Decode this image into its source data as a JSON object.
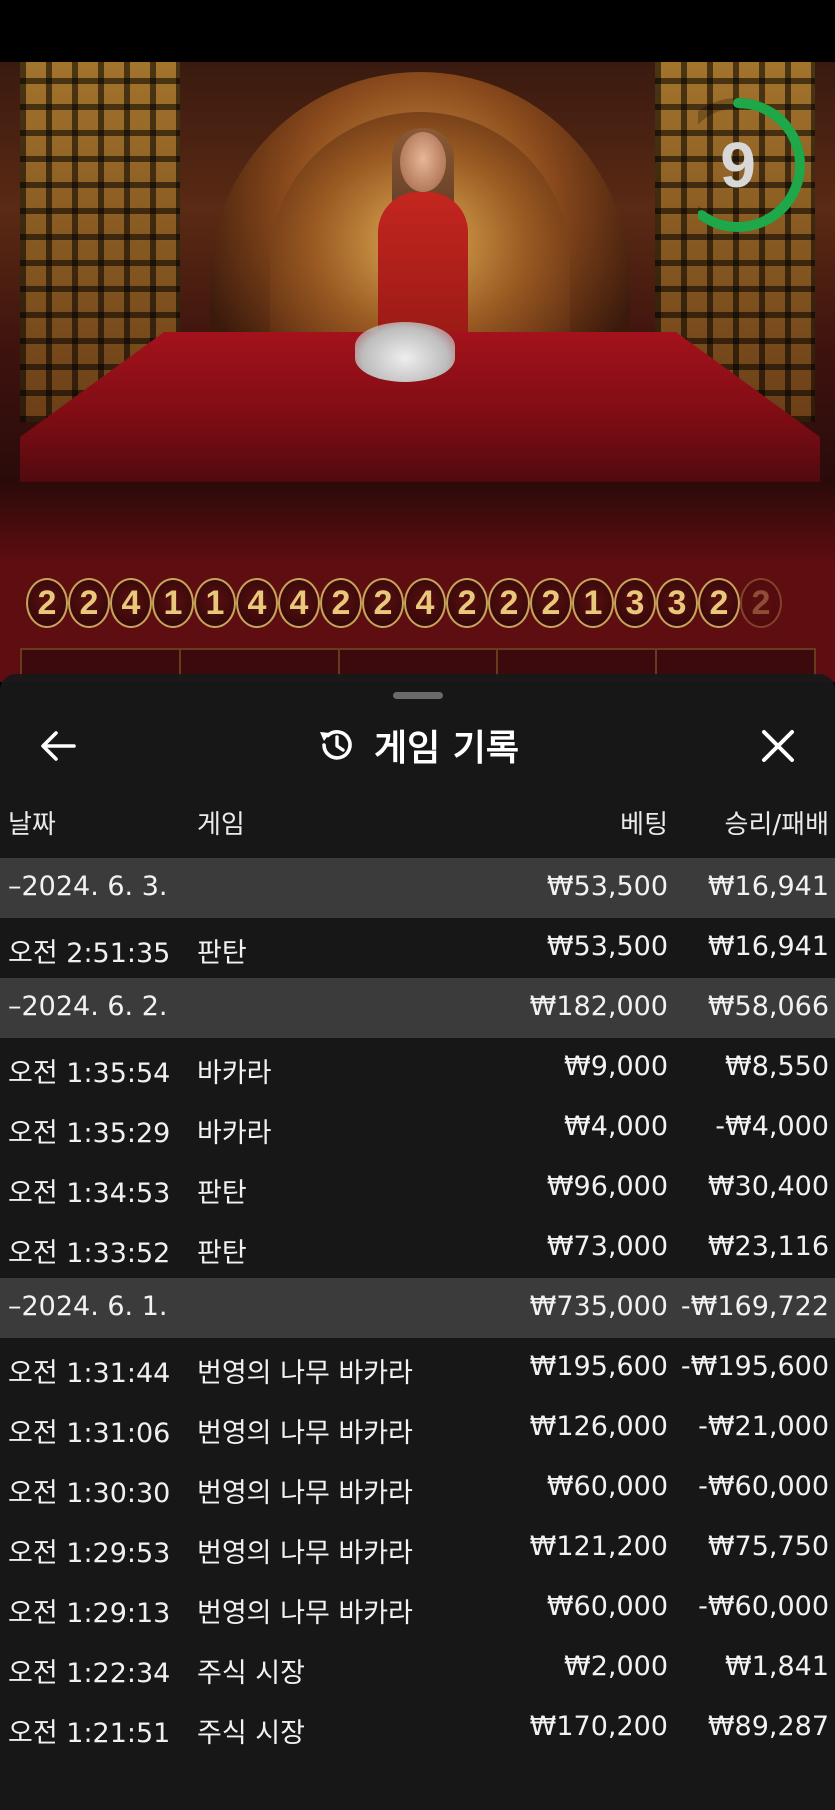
{
  "timer": {
    "value": "9",
    "remaining_fraction": 0.6,
    "color": "#1fa84a"
  },
  "road": {
    "beads": [
      "2",
      "2",
      "4",
      "1",
      "1",
      "4",
      "4",
      "2",
      "2",
      "4",
      "2",
      "2",
      "2",
      "1",
      "3",
      "3",
      "2",
      "2"
    ]
  },
  "history": {
    "title": "게임 기록",
    "columns": {
      "date": "날짜",
      "game": "게임",
      "bet": "베팅",
      "result": "승리/패배"
    },
    "rows": [
      {
        "type": "date",
        "time": "–2024. 6. 3.",
        "game": "",
        "bet": "₩53,500",
        "result": "₩16,941"
      },
      {
        "type": "game",
        "time": "오전 2:51:35",
        "game": "판탄",
        "bet": "₩53,500",
        "result": "₩16,941"
      },
      {
        "type": "date",
        "time": "–2024. 6. 2.",
        "game": "",
        "bet": "₩182,000",
        "result": "₩58,066"
      },
      {
        "type": "game",
        "time": "오전 1:35:54",
        "game": "바카라",
        "bet": "₩9,000",
        "result": "₩8,550"
      },
      {
        "type": "game",
        "time": "오전 1:35:29",
        "game": "바카라",
        "bet": "₩4,000",
        "result": "-₩4,000"
      },
      {
        "type": "game",
        "time": "오전 1:34:53",
        "game": "판탄",
        "bet": "₩96,000",
        "result": "₩30,400"
      },
      {
        "type": "game",
        "time": "오전 1:33:52",
        "game": "판탄",
        "bet": "₩73,000",
        "result": "₩23,116"
      },
      {
        "type": "date",
        "time": "–2024. 6. 1.",
        "game": "",
        "bet": "₩735,000",
        "result": "-₩169,722"
      },
      {
        "type": "game",
        "time": "오전 1:31:44",
        "game": "번영의 나무 바카라",
        "bet": "₩195,600",
        "result": "-₩195,600"
      },
      {
        "type": "game",
        "time": "오전 1:31:06",
        "game": "번영의 나무 바카라",
        "bet": "₩126,000",
        "result": "-₩21,000"
      },
      {
        "type": "game",
        "time": "오전 1:30:30",
        "game": "번영의 나무 바카라",
        "bet": "₩60,000",
        "result": "-₩60,000"
      },
      {
        "type": "game",
        "time": "오전 1:29:53",
        "game": "번영의 나무 바카라",
        "bet": "₩121,200",
        "result": "₩75,750"
      },
      {
        "type": "game",
        "time": "오전 1:29:13",
        "game": "번영의 나무 바카라",
        "bet": "₩60,000",
        "result": "-₩60,000"
      },
      {
        "type": "game",
        "time": "오전 1:22:34",
        "game": "주식 시장",
        "bet": "₩2,000",
        "result": "₩1,841"
      },
      {
        "type": "game",
        "time": "오전 1:21:51",
        "game": "주식 시장",
        "bet": "₩170,200",
        "result": "₩89,287"
      }
    ]
  }
}
